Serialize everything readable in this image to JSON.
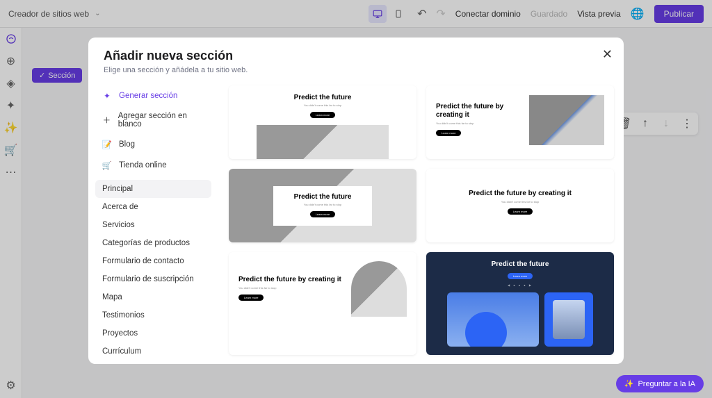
{
  "topbar": {
    "breadcrumb": "Creador de sitios web",
    "connect_domain": "Conectar dominio",
    "saved": "Guardado",
    "preview": "Vista previa",
    "publish": "Publicar"
  },
  "canvas": {
    "section_badge": "Sección"
  },
  "modal": {
    "title": "Añadir nueva sección",
    "subtitle": "Elige una sección y añádela a tu sitio web.",
    "side": {
      "generate": "Generar sección",
      "blank": "Agregar sección en blanco",
      "blog": "Blog",
      "store": "Tienda online"
    },
    "categories": [
      "Principal",
      "Acerca de",
      "Servicios",
      "Categorías de productos",
      "Formulario de contacto",
      "Formulario de suscripción",
      "Mapa",
      "Testimonios",
      "Proyectos",
      "Currículum"
    ],
    "template": {
      "heading1": "Predict the future",
      "heading2": "Predict the future by creating it",
      "cta": "Learn more"
    }
  },
  "ai": {
    "label": "Preguntar a la IA"
  }
}
